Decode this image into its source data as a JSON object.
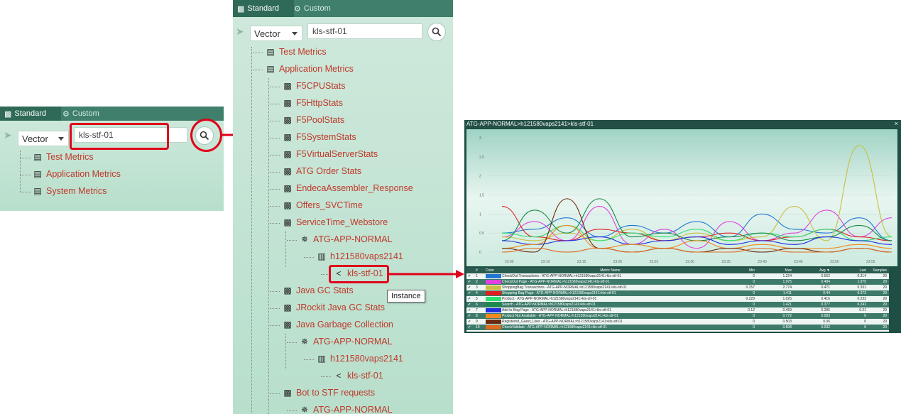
{
  "left_panel": {
    "tabs": [
      {
        "label": "Standard",
        "icon": "bar-chart-icon"
      },
      {
        "label": "Custom",
        "icon": "gear-icon"
      }
    ],
    "select_value": "Vector",
    "search_value": "kls-stf-01",
    "tree": [
      {
        "label": "Test Metrics",
        "icon": "list-icon"
      },
      {
        "label": "Application Metrics",
        "icon": "list-icon"
      },
      {
        "label": "System Metrics",
        "icon": "list-icon"
      }
    ]
  },
  "middle_panel": {
    "tabs": [
      {
        "label": "Standard",
        "icon": "bar-chart-icon"
      },
      {
        "label": "Custom",
        "icon": "gear-icon"
      }
    ],
    "select_value": "Vector",
    "search_value": "kls-stf-01",
    "tree": [
      {
        "label": "Test Metrics",
        "icon": "list-icon"
      },
      {
        "label": "Application Metrics",
        "icon": "list-icon"
      },
      {
        "label": "F5CPUStats",
        "icon": "group-icon"
      },
      {
        "label": "F5HttpStats",
        "icon": "group-icon"
      },
      {
        "label": "F5PoolStats",
        "icon": "group-icon"
      },
      {
        "label": "F5SystemStats",
        "icon": "group-icon"
      },
      {
        "label": "F5VirtualServerStats",
        "icon": "group-icon"
      },
      {
        "label": "ATG Order Stats",
        "icon": "group-icon"
      },
      {
        "label": "EndecaAssembler_Response",
        "icon": "group-icon"
      },
      {
        "label": "Offers_SVCTime",
        "icon": "group-icon"
      },
      {
        "label": "ServiceTime_Webstore",
        "icon": "group-icon"
      },
      {
        "label": "ATG-APP-NORMAL",
        "icon": "tier-icon"
      },
      {
        "label": "h121580vaps2141",
        "icon": "server-icon"
      },
      {
        "label": "kls-stf-01",
        "icon": "share-icon"
      },
      {
        "label": "Java GC Stats",
        "icon": "group-icon"
      },
      {
        "label": "JRockit Java GC Stats",
        "icon": "group-icon"
      },
      {
        "label": "Java Garbage Collection",
        "icon": "group-icon"
      },
      {
        "label": "ATG-APP-NORMAL",
        "icon": "tier-icon"
      },
      {
        "label": "h121580vaps2141",
        "icon": "server-icon"
      },
      {
        "label": "kls-stf-01",
        "icon": "share-icon"
      },
      {
        "label": "Bot to STF requests",
        "icon": "group-icon"
      },
      {
        "label": "ATG-APP-NORMAL",
        "icon": "tier-icon"
      }
    ],
    "tooltip": "Instance"
  },
  "chart_window": {
    "title": "ATG-APP-NORMAL>h121580vaps2141>kls-stf-01",
    "close_label": "×",
    "table_headers": [
      "#",
      "Color",
      "Metric Name",
      "Min",
      "Max",
      "Avg ▼",
      "Last",
      "Samples"
    ],
    "rows": [
      {
        "n": "1",
        "color": "#1f77d4",
        "name": "CheckOut Transactions - ATG-APP-NORMAL>h121580vaps2141>kls-stf-01",
        "min": "0",
        "max": "1.224",
        "avg": "0.562",
        "last": "0.314",
        "samples": "29"
      },
      {
        "n": "2",
        "color": "#e040e0",
        "name": "CheckOut Page - ATG-APP-NORMAL>h121580vaps2141>kls-stf-01",
        "min": "0",
        "max": "1.975",
        "avg": "0.484",
        "last": "1.975",
        "samples": "29"
      },
      {
        "n": "3",
        "color": "#c8c040",
        "name": "ShoppingBag Transactions - ATG-APP-NORMAL>h121580vaps2141>kls-stf-01",
        "min": "0.157",
        "max": "2.774",
        "avg": "0.471",
        "last": "0.331",
        "samples": "29"
      },
      {
        "n": "4",
        "color": "#e02020",
        "name": "Shopping Bag Page - ATG-APP-NORMAL>h121580vaps2141>kls-stf-01",
        "min": "0",
        "max": "1.411",
        "avg": "0.44",
        "last": "0.373",
        "samples": "29"
      },
      {
        "n": "5",
        "color": "#30e070",
        "name": "Product - ATG-APP-NORMAL>h121580vaps2141>kls-stf-01",
        "min": "0.229",
        "max": "1.025",
        "avg": "0.416",
        "last": "0.233",
        "samples": "29"
      },
      {
        "n": "6",
        "color": "#1a8a4a",
        "name": "Search - ATG-APP-NORMAL>h121580vaps2141>kls-stf-01",
        "min": "0",
        "max": "1.421",
        "avg": "0.377",
        "last": "0.242",
        "samples": "29"
      },
      {
        "n": "7",
        "color": "#2030e0",
        "name": "Add to Bag Page - ATG-APP-NORMAL>h121580vaps2141>kls-stf-01",
        "min": "0.12",
        "max": "0.459",
        "avg": "0.285",
        "last": "0.21",
        "samples": "29"
      },
      {
        "n": "8",
        "color": "#f08a20",
        "name": "Product Not Available - ATG-APP-NORMAL>h121580vaps2141>kls-stf-01",
        "min": "0",
        "max": "0.772",
        "avg": "0.083",
        "last": "0",
        "samples": "29"
      },
      {
        "n": "9",
        "color": "#6a2a10",
        "name": "Registered_Guest_User - ATG-APP-NORMAL>h121580vaps2141>kls-stf-01",
        "min": "0",
        "max": "0.503",
        "avg": "0.06",
        "last": "0",
        "samples": "29"
      },
      {
        "n": "10",
        "color": "#e06a20",
        "name": "CheckValidate - ATG-APP-NORMAL>h121580vaps2141>kls-stf-01",
        "min": "0",
        "max": "0.508",
        "avg": "0.032",
        "last": "0",
        "samples": "29"
      }
    ]
  },
  "chart_data": {
    "type": "line",
    "title": "",
    "xlabel": "",
    "ylabel": "",
    "x": [
      "23:05",
      "23:10",
      "23:15",
      "23:20",
      "23:25",
      "23:30",
      "23:35",
      "23:40",
      "23:45",
      "23:50",
      "23:55"
    ],
    "yticks": [
      "0",
      "0.5",
      "1",
      "1.5",
      "2",
      "2.5",
      "3"
    ],
    "ylim": [
      0,
      3
    ],
    "grid": true,
    "series": [
      {
        "name": "CheckOut Transactions - ATG-APP-NORMAL>h121580vaps2141>kls-stf-01",
        "color": "#1f77d4",
        "values": [
          0.5,
          0.6,
          0.9,
          0.4,
          0.7,
          0.5,
          0.8,
          0.4,
          1.0,
          0.6,
          0.5,
          0.9,
          0.3
        ]
      },
      {
        "name": "CheckOut Page - ATG-APP-NORMAL>h121580vaps2141>kls-stf-01",
        "color": "#e040e0",
        "values": [
          0.4,
          0.8,
          0.3,
          1.2,
          0.2,
          0.6,
          0.1,
          0.8,
          0.3,
          0.5,
          1.1,
          0.4,
          0.9
        ]
      },
      {
        "name": "ShoppingBag Transactions - ATG-APP-NORMAL>h121580vaps2141>kls-stf-01",
        "color": "#c8c040",
        "values": [
          0.4,
          0.3,
          0.5,
          0.3,
          0.6,
          0.3,
          0.5,
          0.3,
          0.4,
          1.2,
          0.3,
          2.8,
          0.4
        ]
      },
      {
        "name": "Shopping Bag Page - ATG-APP-NORMAL>h121580vaps2141>kls-stf-01",
        "color": "#e02020",
        "values": [
          1.2,
          0.4,
          0.3,
          0.6,
          0.5,
          0.3,
          0.4,
          0.5,
          0.3,
          0.4,
          0.6,
          0.4,
          0.3
        ]
      },
      {
        "name": "Product - ATG-APP-NORMAL>h121580vaps2141>kls-stf-01",
        "color": "#30e070",
        "values": [
          0.5,
          0.4,
          0.7,
          0.3,
          0.5,
          0.4,
          0.6,
          0.3,
          0.5,
          0.4,
          0.6,
          0.3,
          0.4
        ]
      },
      {
        "name": "Search - ATG-APP-NORMAL>h121580vaps2141>kls-stf-01",
        "color": "#1a8a4a",
        "values": [
          0.3,
          1.1,
          0.5,
          1.4,
          0.4,
          0.5,
          0.3,
          0.4,
          0.5,
          0.3,
          0.4,
          0.7,
          0.3
        ]
      },
      {
        "name": "Add to Bag Page - ATG-APP-NORMAL>h121580vaps2141>kls-stf-01",
        "color": "#2030e0",
        "values": [
          0.3,
          0.2,
          0.3,
          0.4,
          0.2,
          0.3,
          0.4,
          0.2,
          0.3,
          0.2,
          0.4,
          0.3,
          0.2
        ]
      },
      {
        "name": "Product Not Available - ATG-APP-NORMAL>h121580vaps2141>kls-stf-01",
        "color": "#f08a20",
        "values": [
          0.1,
          0.2,
          0.7,
          0.1,
          0.2,
          0.1,
          0.3,
          0.1,
          0.2,
          0.1,
          0.1,
          0.2,
          0.1
        ]
      },
      {
        "name": "Registered_Guest_User - ATG-APP-NORMAL>h121580vaps2141>kls-stf-01",
        "color": "#6a2a10",
        "values": [
          0.1,
          0.0,
          1.4,
          0.1,
          0.0,
          0.1,
          0.0,
          0.1,
          0.0,
          0.1,
          0.0,
          0.1,
          0.0
        ]
      },
      {
        "name": "CheckValidate - ATG-APP-NORMAL>h121580vaps2141>kls-stf-01",
        "color": "#e06a20",
        "values": [
          0.0,
          0.1,
          0.0,
          0.1,
          0.0,
          0.1,
          0.0,
          0.0,
          0.1,
          0.0,
          0.0,
          0.1,
          0.0
        ]
      }
    ]
  },
  "accent_colors": {
    "highlight": "#e0001a",
    "tabbar": "#3f7f6b",
    "tree_text": "#c0392b"
  }
}
